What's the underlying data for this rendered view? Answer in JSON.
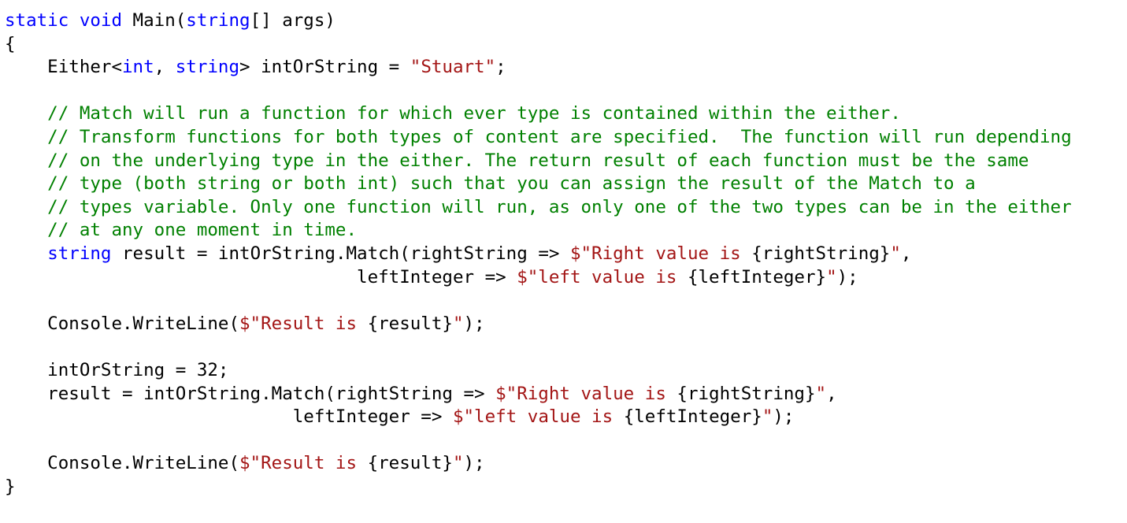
{
  "colors": {
    "keyword": "#0000ff",
    "string": "#a31515",
    "comment": "#008000",
    "text": "#000000",
    "background": "#ffffff"
  },
  "code": {
    "lines": [
      [
        {
          "t": "kw",
          "v": "static"
        },
        {
          "t": "txt",
          "v": " "
        },
        {
          "t": "kw",
          "v": "void"
        },
        {
          "t": "txt",
          "v": " Main("
        },
        {
          "t": "kw",
          "v": "string"
        },
        {
          "t": "txt",
          "v": "[] args)"
        }
      ],
      [
        {
          "t": "txt",
          "v": "{"
        }
      ],
      [
        {
          "t": "txt",
          "v": "    Either<"
        },
        {
          "t": "kw",
          "v": "int"
        },
        {
          "t": "txt",
          "v": ", "
        },
        {
          "t": "kw",
          "v": "string"
        },
        {
          "t": "txt",
          "v": "> intOrString = "
        },
        {
          "t": "str",
          "v": "\"Stuart\""
        },
        {
          "t": "txt",
          "v": ";"
        }
      ],
      [],
      [
        {
          "t": "cm",
          "v": "    // Match will run a function for which ever type is contained within the either."
        }
      ],
      [
        {
          "t": "cm",
          "v": "    // Transform functions for both types of content are specified.  The function will run depending"
        }
      ],
      [
        {
          "t": "cm",
          "v": "    // on the underlying type in the either. The return result of each function must be the same"
        }
      ],
      [
        {
          "t": "cm",
          "v": "    // type (both string or both int) such that you can assign the result of the Match to a"
        }
      ],
      [
        {
          "t": "cm",
          "v": "    // types variable. Only one function will run, as only one of the two types can be in the either"
        }
      ],
      [
        {
          "t": "cm",
          "v": "    // at any one moment in time."
        }
      ],
      [
        {
          "t": "txt",
          "v": "    "
        },
        {
          "t": "kw",
          "v": "string"
        },
        {
          "t": "txt",
          "v": " result = intOrString.Match(rightString => "
        },
        {
          "t": "str",
          "v": "$\"Right value is "
        },
        {
          "t": "txt",
          "v": "{rightString}"
        },
        {
          "t": "str",
          "v": "\""
        },
        {
          "t": "txt",
          "v": ","
        }
      ],
      [
        {
          "t": "txt",
          "v": "                                 leftInteger => "
        },
        {
          "t": "str",
          "v": "$\"left value is "
        },
        {
          "t": "txt",
          "v": "{leftInteger}"
        },
        {
          "t": "str",
          "v": "\""
        },
        {
          "t": "txt",
          "v": ");"
        }
      ],
      [],
      [
        {
          "t": "txt",
          "v": "    Console.WriteLine("
        },
        {
          "t": "str",
          "v": "$\"Result is "
        },
        {
          "t": "txt",
          "v": "{result}"
        },
        {
          "t": "str",
          "v": "\""
        },
        {
          "t": "txt",
          "v": ");"
        }
      ],
      [],
      [
        {
          "t": "txt",
          "v": "    intOrString = 32;"
        }
      ],
      [
        {
          "t": "txt",
          "v": "    result = intOrString.Match(rightString => "
        },
        {
          "t": "str",
          "v": "$\"Right value is "
        },
        {
          "t": "txt",
          "v": "{rightString}"
        },
        {
          "t": "str",
          "v": "\""
        },
        {
          "t": "txt",
          "v": ","
        }
      ],
      [
        {
          "t": "txt",
          "v": "                           leftInteger => "
        },
        {
          "t": "str",
          "v": "$\"left value is "
        },
        {
          "t": "txt",
          "v": "{leftInteger}"
        },
        {
          "t": "str",
          "v": "\""
        },
        {
          "t": "txt",
          "v": ");"
        }
      ],
      [],
      [
        {
          "t": "txt",
          "v": "    Console.WriteLine("
        },
        {
          "t": "str",
          "v": "$\"Result is "
        },
        {
          "t": "txt",
          "v": "{result}"
        },
        {
          "t": "str",
          "v": "\""
        },
        {
          "t": "txt",
          "v": ");"
        }
      ],
      [
        {
          "t": "txt",
          "v": "}"
        }
      ]
    ]
  }
}
